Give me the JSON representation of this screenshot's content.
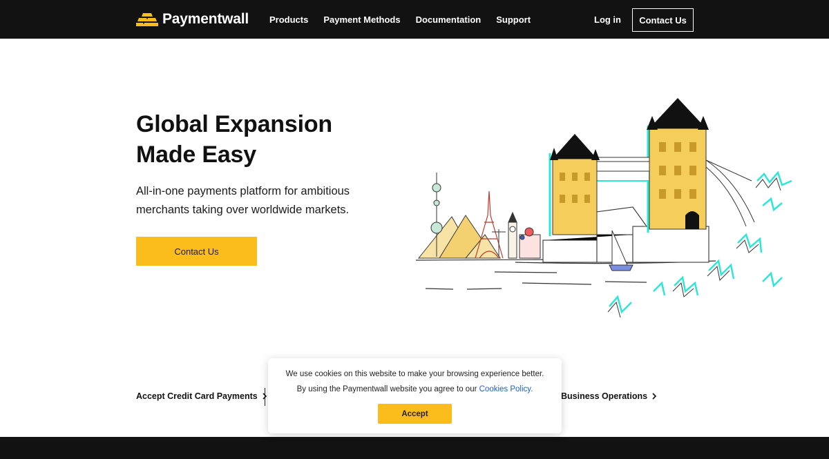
{
  "header": {
    "brand": "Paymentwall",
    "nav": [
      "Products",
      "Payment Methods",
      "Documentation",
      "Support"
    ],
    "login": "Log in",
    "cta": "Contact Us"
  },
  "hero": {
    "title_line1": "Global Expansion",
    "title_line2": "Made Easy",
    "subtitle": "All-in-one payments platform for ambitious merchants taking over worldwide markets.",
    "cta": "Contact Us"
  },
  "quick_links": {
    "left": "Accept Credit Card Payments",
    "right": "Business Operations"
  },
  "cookie": {
    "line1": "We use cookies on this website to make your browsing experience better.",
    "line2_prefix": "By using the Paymentwall website you agree to our ",
    "link": "Cookies Policy.",
    "accept": "Accept"
  },
  "colors": {
    "accent": "#fbbd1c",
    "header_bg": "#121212",
    "link": "#1a5fd6",
    "illustration_teal": "#2ee6d6",
    "illustration_gold": "#f4cd5b"
  },
  "icons": [
    "gold-bars-logo-icon",
    "chevron-right-icon",
    "landmarks-illustration"
  ]
}
